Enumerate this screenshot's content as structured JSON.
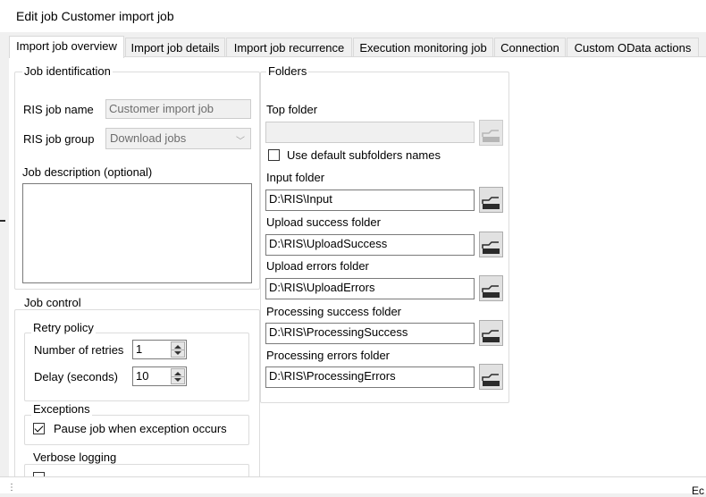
{
  "window": {
    "title": "Edit job Customer import job"
  },
  "tabs": [
    {
      "label": "Import job overview",
      "active": true
    },
    {
      "label": "Import job details",
      "active": false
    },
    {
      "label": "Import job recurrence",
      "active": false
    },
    {
      "label": "Execution monitoring job",
      "active": false
    },
    {
      "label": "Connection",
      "active": false
    },
    {
      "label": "Custom OData actions",
      "active": false
    }
  ],
  "job_identification": {
    "title": "Job identification",
    "ris_job_name_label": "RIS job name",
    "ris_job_name_value": "Customer import job",
    "ris_job_group_label": "RIS job group",
    "ris_job_group_value": "Download jobs",
    "job_description_label": "Job description (optional)",
    "job_description_value": ""
  },
  "job_control": {
    "title": "Job control",
    "retry_policy": {
      "title": "Retry policy",
      "retries_label": "Number of retries",
      "retries_value": "1",
      "delay_label": "Delay (seconds)",
      "delay_value": "10"
    },
    "exceptions": {
      "title": "Exceptions",
      "pause_label": "Pause job when exception occurs",
      "pause_checked": true
    },
    "verbose_logging": {
      "title": "Verbose logging"
    }
  },
  "folders": {
    "title": "Folders",
    "top_folder_label": "Top folder",
    "top_folder_value": "",
    "use_default_label": "Use default subfolders names",
    "use_default_checked": false,
    "input_folder_label": "Input folder",
    "input_folder_value": "D:\\RIS\\Input",
    "upload_success_label": "Upload success folder",
    "upload_success_value": "D:\\RIS\\UploadSuccess",
    "upload_errors_label": "Upload errors folder",
    "upload_errors_value": "D:\\RIS\\UploadErrors",
    "processing_success_label": "Processing success folder",
    "processing_success_value": "D:\\RIS\\ProcessingSuccess",
    "processing_errors_label": "Processing errors folder",
    "processing_errors_value": "D:\\RIS\\ProcessingErrors"
  },
  "status": {
    "fragment": "Ec"
  },
  "colors": {
    "accent_dark": "#2b2b2b",
    "border": "#7a7a7a",
    "page": "#ffffff",
    "chrome": "#f0f0f0"
  }
}
